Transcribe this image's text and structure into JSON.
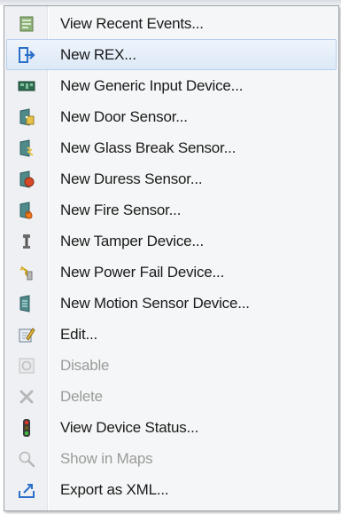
{
  "menu": {
    "items": [
      {
        "label": "View Recent Events...",
        "icon": "recent-events-icon",
        "enabled": true,
        "highlighted": false
      },
      {
        "label": "New REX...",
        "icon": "rex-exit-icon",
        "enabled": true,
        "highlighted": true
      },
      {
        "label": "New Generic Input Device...",
        "icon": "generic-input-device-icon",
        "enabled": true,
        "highlighted": false
      },
      {
        "label": "New Door Sensor...",
        "icon": "door-sensor-icon",
        "enabled": true,
        "highlighted": false
      },
      {
        "label": "New Glass Break Sensor...",
        "icon": "glass-break-sensor-icon",
        "enabled": true,
        "highlighted": false
      },
      {
        "label": "New Duress Sensor...",
        "icon": "duress-sensor-icon",
        "enabled": true,
        "highlighted": false
      },
      {
        "label": "New Fire Sensor...",
        "icon": "fire-sensor-icon",
        "enabled": true,
        "highlighted": false
      },
      {
        "label": "New Tamper Device...",
        "icon": "tamper-device-icon",
        "enabled": true,
        "highlighted": false
      },
      {
        "label": "New Power Fail Device...",
        "icon": "power-fail-device-icon",
        "enabled": true,
        "highlighted": false
      },
      {
        "label": "New Motion Sensor Device...",
        "icon": "motion-sensor-icon",
        "enabled": true,
        "highlighted": false
      },
      {
        "label": "Edit...",
        "icon": "edit-icon",
        "enabled": true,
        "highlighted": false
      },
      {
        "label": "Disable",
        "icon": "disable-icon",
        "enabled": false,
        "highlighted": false
      },
      {
        "label": "Delete",
        "icon": "delete-icon",
        "enabled": false,
        "highlighted": false
      },
      {
        "label": "View Device Status...",
        "icon": "device-status-icon",
        "enabled": true,
        "highlighted": false
      },
      {
        "label": "Show in Maps",
        "icon": "show-in-maps-icon",
        "enabled": false,
        "highlighted": false
      },
      {
        "label": "Export as XML...",
        "icon": "export-xml-icon",
        "enabled": true,
        "highlighted": false
      }
    ]
  },
  "colors": {
    "highlight_border": "#b8d0ee",
    "disabled_text": "#9a9a9a",
    "rex_blue": "#2b6fc9"
  }
}
